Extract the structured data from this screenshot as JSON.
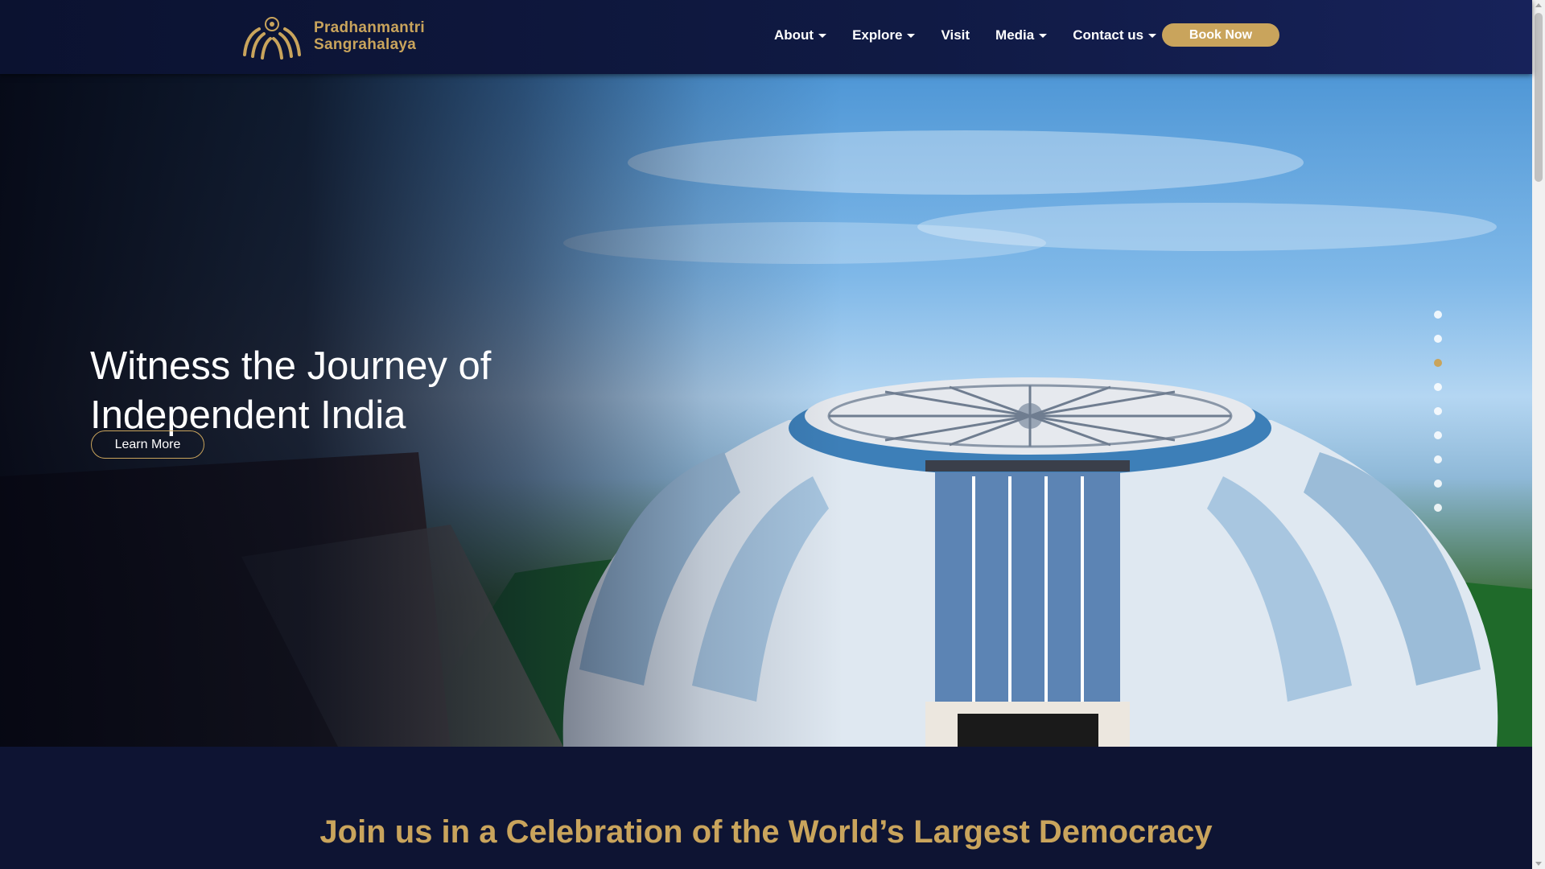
{
  "header": {
    "logo_line1": "Pradhanmantri",
    "logo_line2": "Sangrahalaya",
    "nav": [
      {
        "label": "About",
        "has_dropdown": true
      },
      {
        "label": "Explore",
        "has_dropdown": true
      },
      {
        "label": "Visit",
        "has_dropdown": false
      },
      {
        "label": "Media",
        "has_dropdown": true
      },
      {
        "label": "Contact us",
        "has_dropdown": true
      }
    ],
    "book_label": "Book Now"
  },
  "hero": {
    "title": "Witness the Journey of Independent India",
    "cta_label": "Learn More",
    "slide_count": 9,
    "active_slide": 3
  },
  "section": {
    "heading": "Join us in a Celebration of the World’s Largest Democracy"
  },
  "colors": {
    "navy": "#0d1230",
    "gold": "#c9a45c",
    "white": "#ffffff"
  }
}
